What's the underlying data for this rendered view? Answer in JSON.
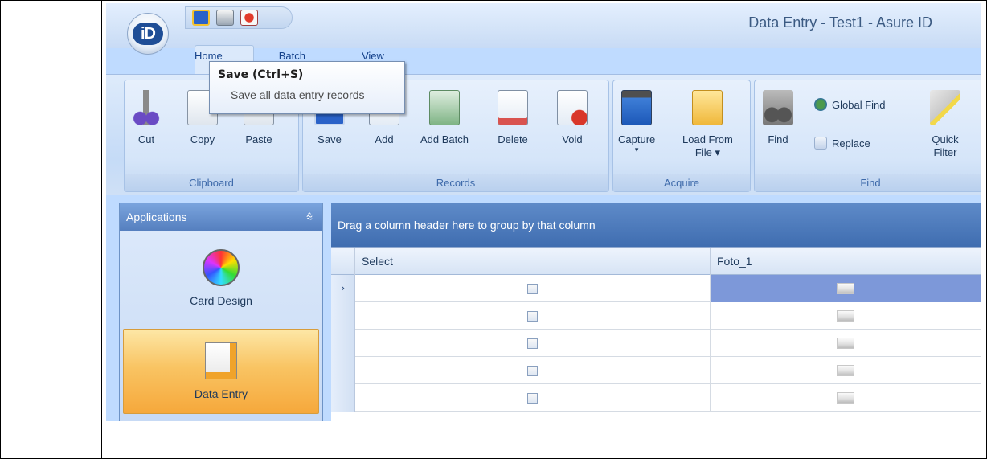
{
  "window": {
    "title": "Data Entry - Test1 - Asure ID",
    "logo_text": "iD"
  },
  "quick_access": {
    "icons": [
      "save-icon",
      "print-icon",
      "exit-icon"
    ]
  },
  "tabs": [
    "Home",
    "Batch",
    "View"
  ],
  "tooltip": {
    "title": "Save (Ctrl+S)",
    "text": "Save all data entry records"
  },
  "ribbon": {
    "clipboard": {
      "label": "Clipboard",
      "cut": "Cut",
      "copy": "Copy",
      "paste": "Paste"
    },
    "records": {
      "label": "Records",
      "save": "Save",
      "add": "Add",
      "add_batch": "Add Batch",
      "delete": "Delete",
      "void": "Void"
    },
    "acquire": {
      "label": "Acquire",
      "capture": "Capture",
      "load_line1": "Load From",
      "load_line2": "File ▾"
    },
    "find": {
      "label": "Find",
      "find": "Find",
      "global_find": "Global Find",
      "replace": "Replace",
      "quick_line1": "Quick",
      "quick_line2": "Filter"
    }
  },
  "applications": {
    "title": "Applications",
    "pin": "⩯",
    "items": [
      {
        "label": "Card Design",
        "icon": "color-wheel-icon",
        "active": false
      },
      {
        "label": "Data Entry",
        "icon": "edit-document-icon",
        "active": true
      }
    ]
  },
  "grid": {
    "group_hint": "Drag a column header here to group by that column",
    "columns": [
      "Select",
      "Foto_1"
    ],
    "row_indicator": "›",
    "rows": [
      {
        "selected": true
      },
      {
        "selected": false
      },
      {
        "selected": false
      },
      {
        "selected": false
      },
      {
        "selected": false
      }
    ]
  },
  "colors": {
    "accent": "#15428b",
    "active_item": "#f9c463",
    "selected_cell": "#7d98d9"
  }
}
